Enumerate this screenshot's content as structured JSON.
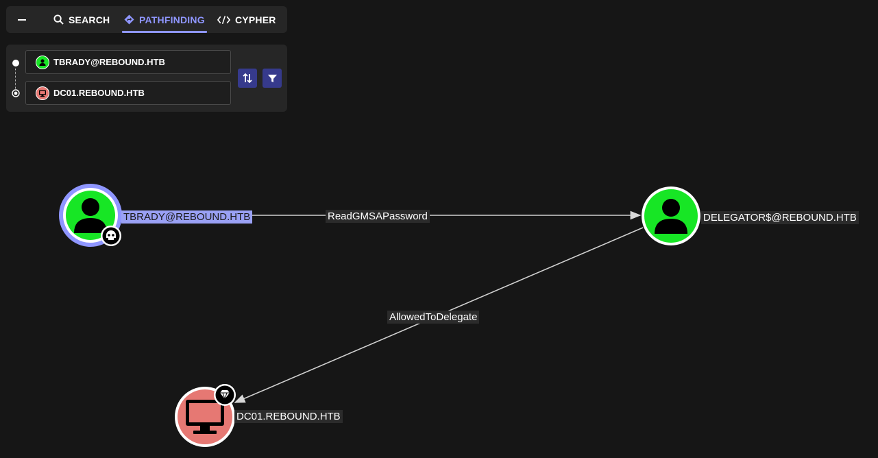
{
  "tabs": {
    "search": "SEARCH",
    "pathfinding": "PATHFINDING",
    "cypher": "CYPHER",
    "active": "pathfinding"
  },
  "pathfinding": {
    "start_value": "TBRADY@REBOUND.HTB",
    "start_icon": "user-icon",
    "target_value": "DC01.REBOUND.HTB",
    "target_icon": "computer-icon",
    "swap_icon": "swap-icon",
    "filter_icon": "filter-icon"
  },
  "graph": {
    "nodes": [
      {
        "id": "tbrady",
        "label": "TBRADY@REBOUND.HTB",
        "type": "User",
        "color": "#17e625",
        "badge": "skull-icon",
        "selected": true
      },
      {
        "id": "delegator",
        "label": "DELEGATOR$@REBOUND.HTB",
        "type": "User",
        "color": "#17e625"
      },
      {
        "id": "dc01",
        "label": "DC01.REBOUND.HTB",
        "type": "Computer",
        "color": "#e67873",
        "badge": "diamond-icon"
      }
    ],
    "edges": [
      {
        "from": "tbrady",
        "to": "delegator",
        "label": "ReadGMSAPassword"
      },
      {
        "from": "delegator",
        "to": "dc01",
        "label": "AllowedToDelegate"
      }
    ]
  },
  "colors": {
    "background": "#161616",
    "accent": "#8f96ff",
    "user_node": "#17e625",
    "computer_node": "#e67873",
    "selection": "#9aa1f5"
  }
}
